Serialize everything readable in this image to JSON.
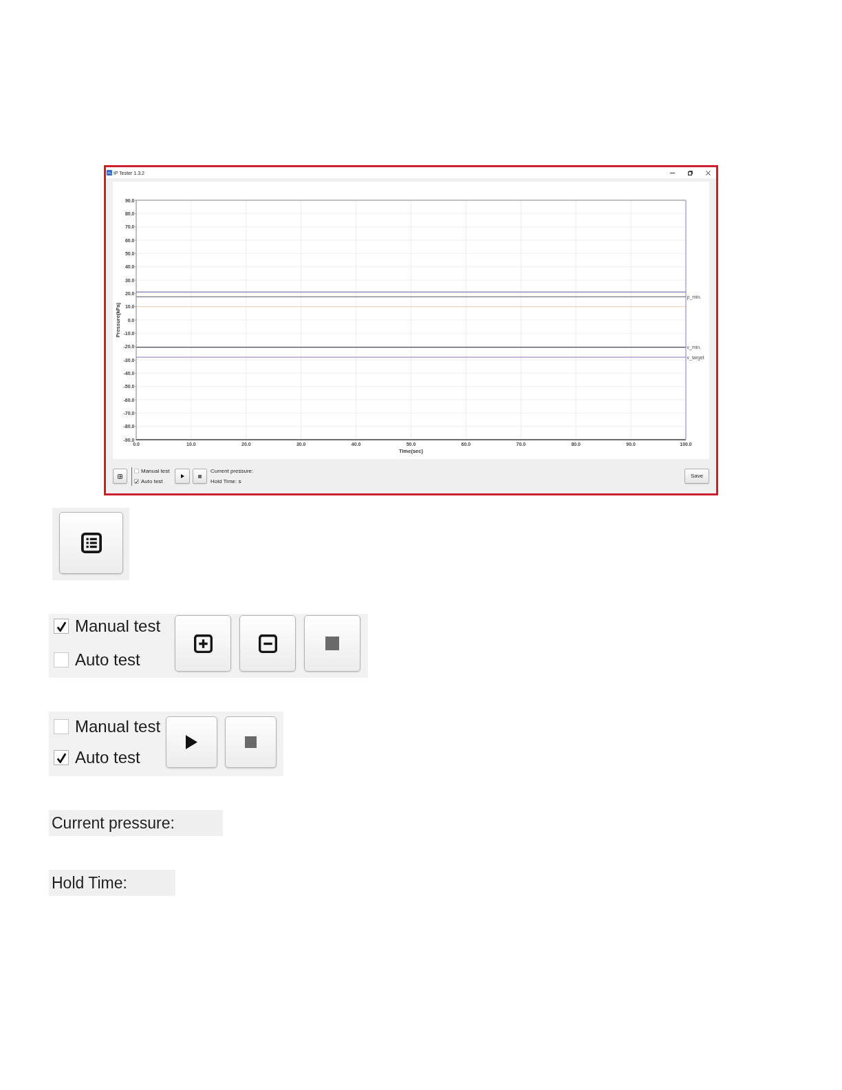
{
  "window": {
    "title": "IP Tester 1.3.2"
  },
  "chart": {
    "chart_data": {
      "type": "line",
      "grid": true,
      "xlabel": "Time(sec)",
      "ylabel": "Pressure(kPa)",
      "x": [
        0,
        100
      ],
      "xlim": [
        0,
        100
      ],
      "ylim": [
        -90,
        90
      ],
      "xticks": [
        {
          "value": 0,
          "label": "0.0"
        },
        {
          "value": 10,
          "label": "10.0"
        },
        {
          "value": 20,
          "label": "20.0"
        },
        {
          "value": 30,
          "label": "30.0"
        },
        {
          "value": 40,
          "label": "40.0"
        },
        {
          "value": 50,
          "label": "50.0"
        },
        {
          "value": 60,
          "label": "60.0"
        },
        {
          "value": 70,
          "label": "70.0"
        },
        {
          "value": 80,
          "label": "80.0"
        },
        {
          "value": 90,
          "label": "90.0"
        },
        {
          "value": 100,
          "label": "100.0"
        }
      ],
      "yticks": [
        {
          "value": 90,
          "label": "90.0"
        },
        {
          "value": 80,
          "label": "80.0"
        },
        {
          "value": 70,
          "label": "70.0"
        },
        {
          "value": 60,
          "label": "60.0"
        },
        {
          "value": 50,
          "label": "50.0"
        },
        {
          "value": 40,
          "label": "40.0"
        },
        {
          "value": 30,
          "label": "30.0"
        },
        {
          "value": 20,
          "label": "20.0"
        },
        {
          "value": 10,
          "label": "10.0"
        },
        {
          "value": 0,
          "label": "0.0"
        },
        {
          "value": -10,
          "label": "-10.0"
        },
        {
          "value": -20,
          "label": "-20.0"
        },
        {
          "value": -30,
          "label": "-30.0"
        },
        {
          "value": -40,
          "label": "-40.0"
        },
        {
          "value": -50,
          "label": "-50.0"
        },
        {
          "value": -60,
          "label": "-60.0"
        },
        {
          "value": -70,
          "label": "-70.0"
        },
        {
          "value": -80,
          "label": "-80.0"
        },
        {
          "value": -90,
          "label": "-90.0"
        }
      ],
      "series": [
        {
          "color": "#7f7cc0",
          "values": [
            21,
            21
          ]
        },
        {
          "name": "p_min.",
          "color": "#55575f",
          "values": [
            17.5,
            17.5
          ]
        },
        {
          "color": "#f0cfa8",
          "values": [
            10,
            10
          ]
        },
        {
          "name": "v_min.",
          "color": "#4f5058",
          "values": [
            -20.5,
            -20.5
          ]
        },
        {
          "name": "v_target",
          "color": "#a090c0",
          "values": [
            -28,
            -28
          ]
        }
      ]
    }
  },
  "toolbar": {
    "checkboxes": [
      {
        "label": "Manual test",
        "checked": false
      },
      {
        "label": "Auto test",
        "checked": true
      }
    ],
    "current_pressure": "Current pressure:",
    "hold_time": "Hold Time: s",
    "save": "Save"
  },
  "details": [
    {
      "kind": "list_button"
    },
    {
      "kind": "manual",
      "checkboxes": [
        {
          "label": "Manual test",
          "checked": true
        },
        {
          "label": "Auto test",
          "checked": false
        }
      ]
    },
    {
      "kind": "auto",
      "checkboxes": [
        {
          "label": "Manual test",
          "checked": false
        },
        {
          "label": "Auto test",
          "checked": true
        }
      ]
    },
    {
      "kind": "label",
      "text": "Current pressure:"
    },
    {
      "kind": "label",
      "text": "Hold Time:"
    }
  ]
}
